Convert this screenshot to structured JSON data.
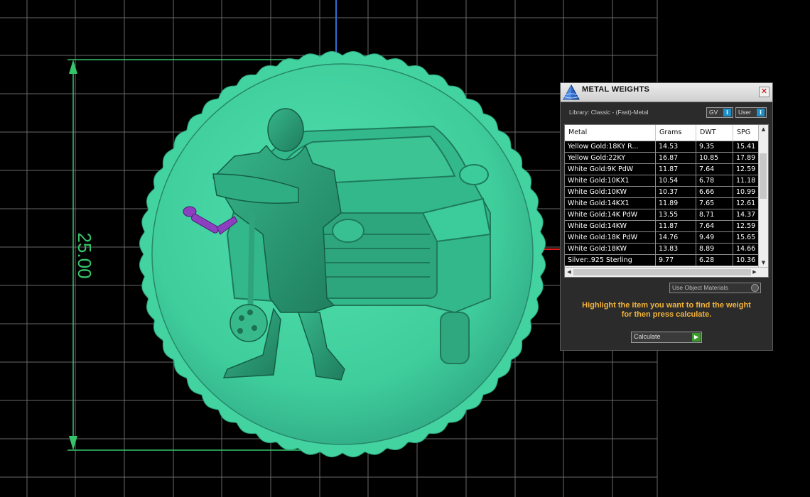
{
  "viewport": {
    "dimension_label": "25.00",
    "colors": {
      "grid": "#8d8d8d",
      "model": "#3fcd9c",
      "dimension": "#35c46a",
      "axis_red": "#e21b1b",
      "axis_blue": "#2f6ed1",
      "weapon": "#8c3fbf"
    }
  },
  "panel": {
    "title": "METAL WEIGHTS",
    "close_glyph": "✕",
    "library_label": "Library: Classic - (Fast)-Metal",
    "gv_label": "GV",
    "user_label": "User",
    "table": {
      "columns": [
        "Metal",
        "Grams",
        "DWT",
        "SPG"
      ],
      "rows": [
        [
          "Yellow Gold:18KY R...",
          "14.53",
          "9.35",
          "15.41"
        ],
        [
          "Yellow Gold:22KY",
          "16.87",
          "10.85",
          "17.89"
        ],
        [
          "White Gold:9K PdW",
          "11.87",
          "7.64",
          "12.59"
        ],
        [
          "White Gold:10KX1",
          "10.54",
          "6.78",
          "11.18"
        ],
        [
          "White Gold:10KW",
          "10.37",
          "6.66",
          "10.99"
        ],
        [
          "White Gold:14KX1",
          "11.89",
          "7.65",
          "12.61"
        ],
        [
          "White Gold:14K PdW",
          "13.55",
          "8.71",
          "14.37"
        ],
        [
          "White Gold:14KW",
          "11.87",
          "7.64",
          "12.59"
        ],
        [
          "White Gold:18K PdW",
          "14.76",
          "9.49",
          "15.65"
        ],
        [
          "White Gold:18KW",
          "13.83",
          "8.89",
          "14.66"
        ],
        [
          "Silver:.925 Sterling",
          "9.77",
          "6.28",
          "10.36"
        ]
      ]
    },
    "use_object_label": "Use Object Materials",
    "hint_line1": "Highlight the item you want to find the weight",
    "hint_line2": "for then press calculate.",
    "calculate_label": "Calculate"
  }
}
